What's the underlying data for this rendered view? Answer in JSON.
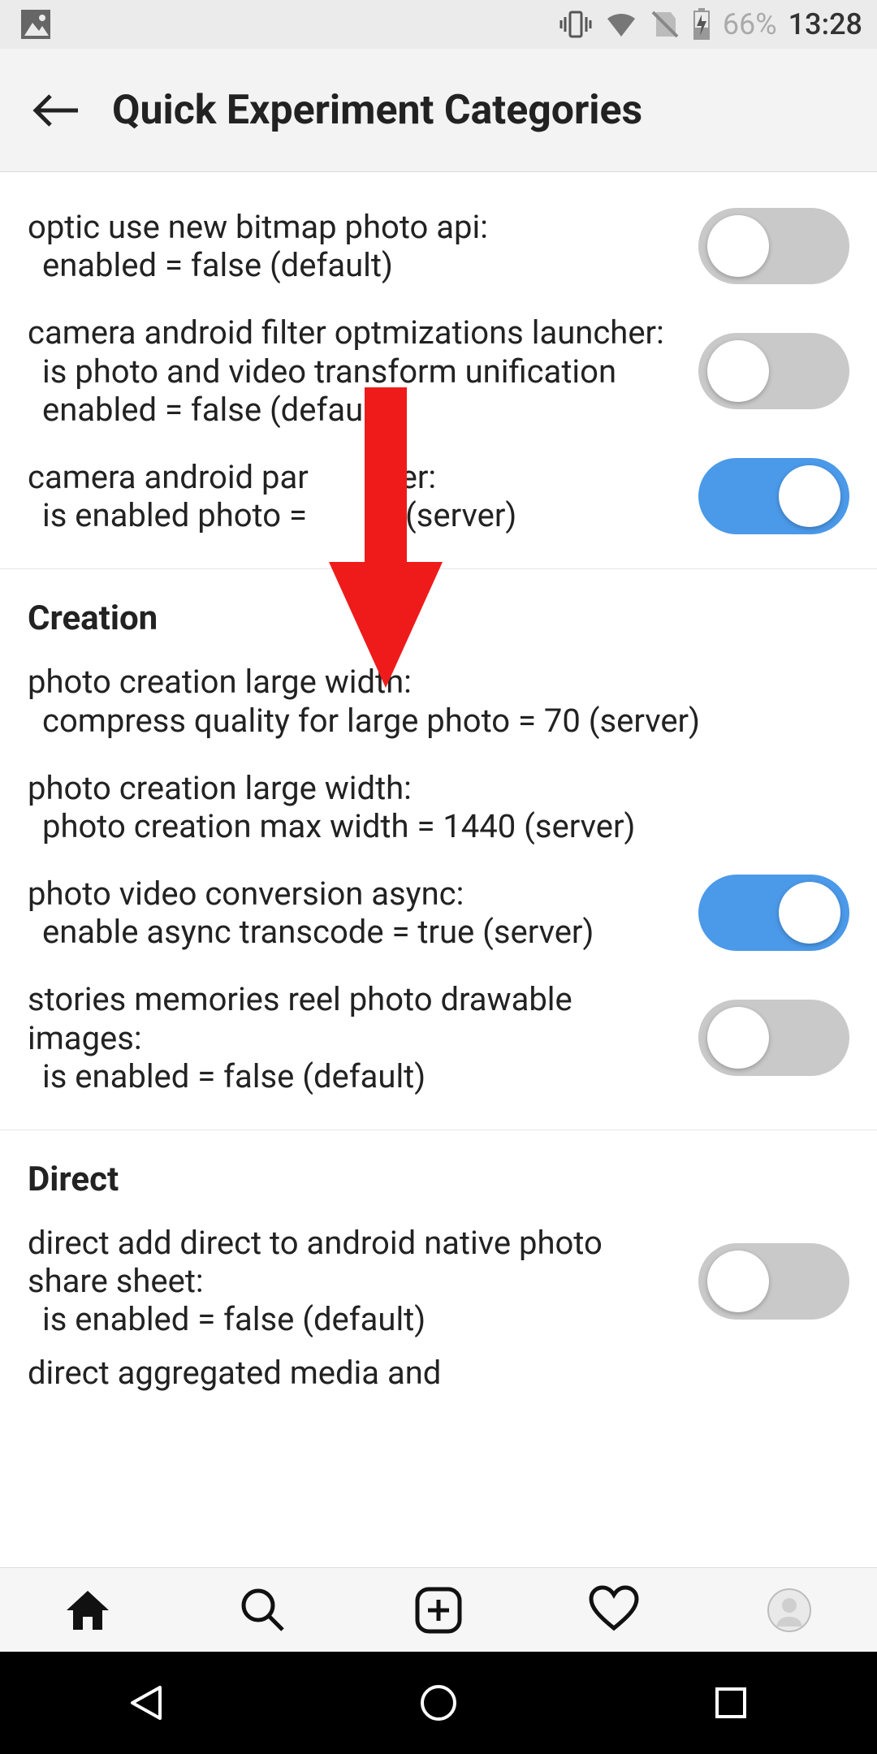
{
  "statusbar": {
    "battery": "66%",
    "time": "13:28"
  },
  "appbar": {
    "title": "Quick Experiment Categories"
  },
  "sections": {
    "first": {
      "items": [
        {
          "title": "optic use new bitmap photo api:",
          "detail": "enabled = false (default)"
        },
        {
          "title": "camera android filter optmizations launcher:",
          "detail": "is photo and video transform unification enabled = false (default)"
        },
        {
          "title_a": "camera android par",
          "title_b": "lter:",
          "detail_a": "is enabled photo =",
          "detail_b": "e (server)"
        }
      ]
    },
    "creation": {
      "title": "Creation",
      "items": [
        {
          "title": "photo creation large width:",
          "detail": "compress quality for large photo = 70 (server)"
        },
        {
          "title": "photo creation large width:",
          "detail": "photo creation max width = 1440 (server)"
        },
        {
          "title": "photo video conversion async:",
          "detail": "enable async transcode = true (server)"
        },
        {
          "title": "stories memories reel photo drawable images:",
          "detail": "is enabled = false (default)"
        }
      ]
    },
    "direct": {
      "title": "Direct",
      "items": [
        {
          "title": "direct add direct to android native photo share sheet:",
          "detail": "is enabled = false (default)"
        },
        {
          "title_partial": "direct aggregated media and"
        }
      ]
    }
  }
}
